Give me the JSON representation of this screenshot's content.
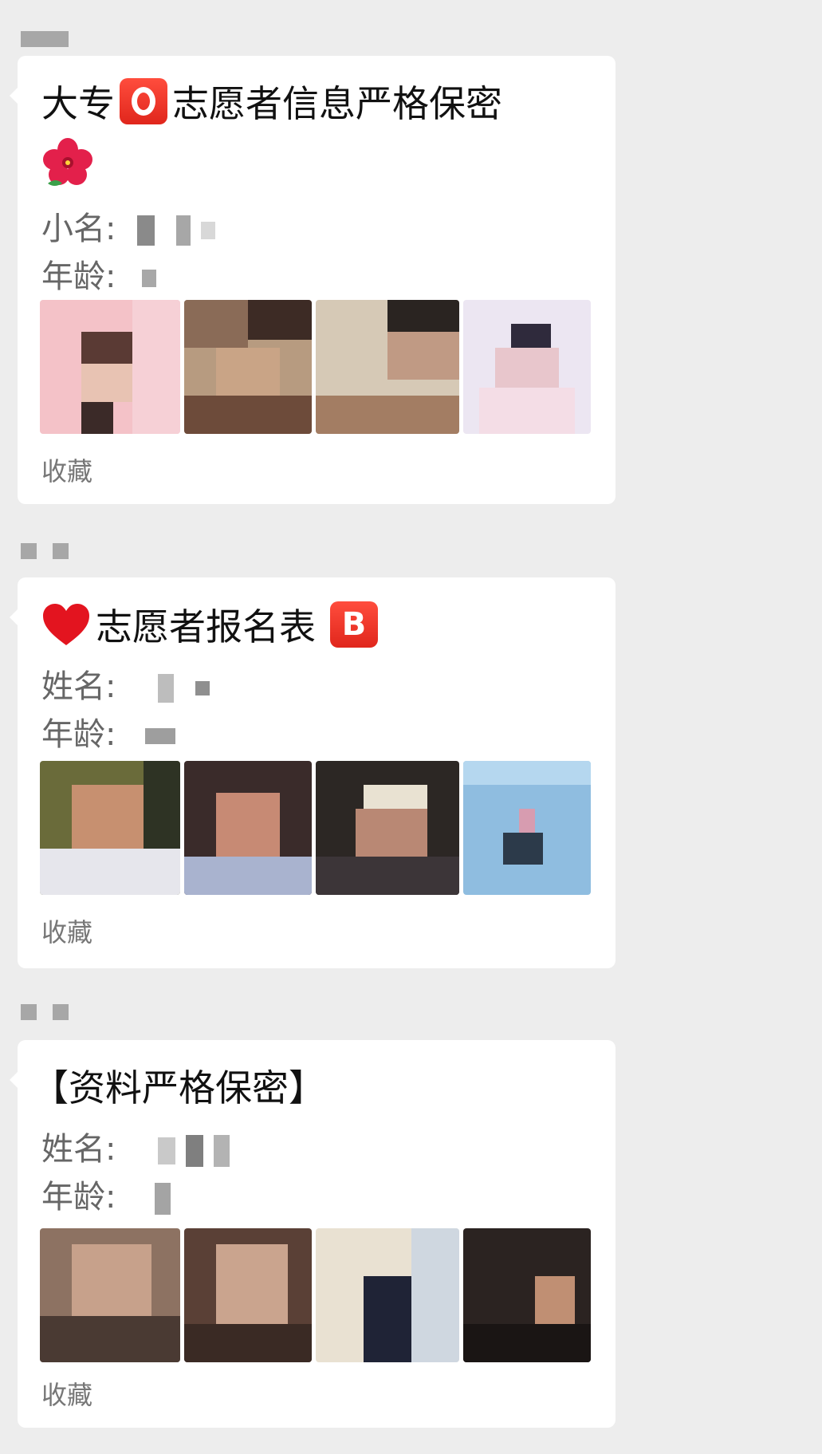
{
  "messages": [
    {
      "title_prefix": "大专",
      "title_suffix": "志愿者信息严格保密",
      "emoji_letter": "",
      "fields": [
        {
          "label": "小名:"
        },
        {
          "label": "年龄:"
        }
      ],
      "favorite_label": "收藏"
    },
    {
      "title_text": "志愿者报名表",
      "emoji_letter": "B",
      "fields": [
        {
          "label": "姓名:"
        },
        {
          "label": "年龄:"
        }
      ],
      "favorite_label": "收藏"
    },
    {
      "title_text": "【资料严格保密】",
      "fields": [
        {
          "label": "姓名:"
        },
        {
          "label": "年龄:"
        }
      ],
      "favorite_label": "收藏"
    }
  ],
  "colors": {
    "background": "#ededed",
    "bubble": "#ffffff",
    "emoji_red": "#e0261c"
  },
  "icons": [
    "hibiscus-icon",
    "heart-icon",
    "o-button-icon",
    "b-button-icon"
  ]
}
